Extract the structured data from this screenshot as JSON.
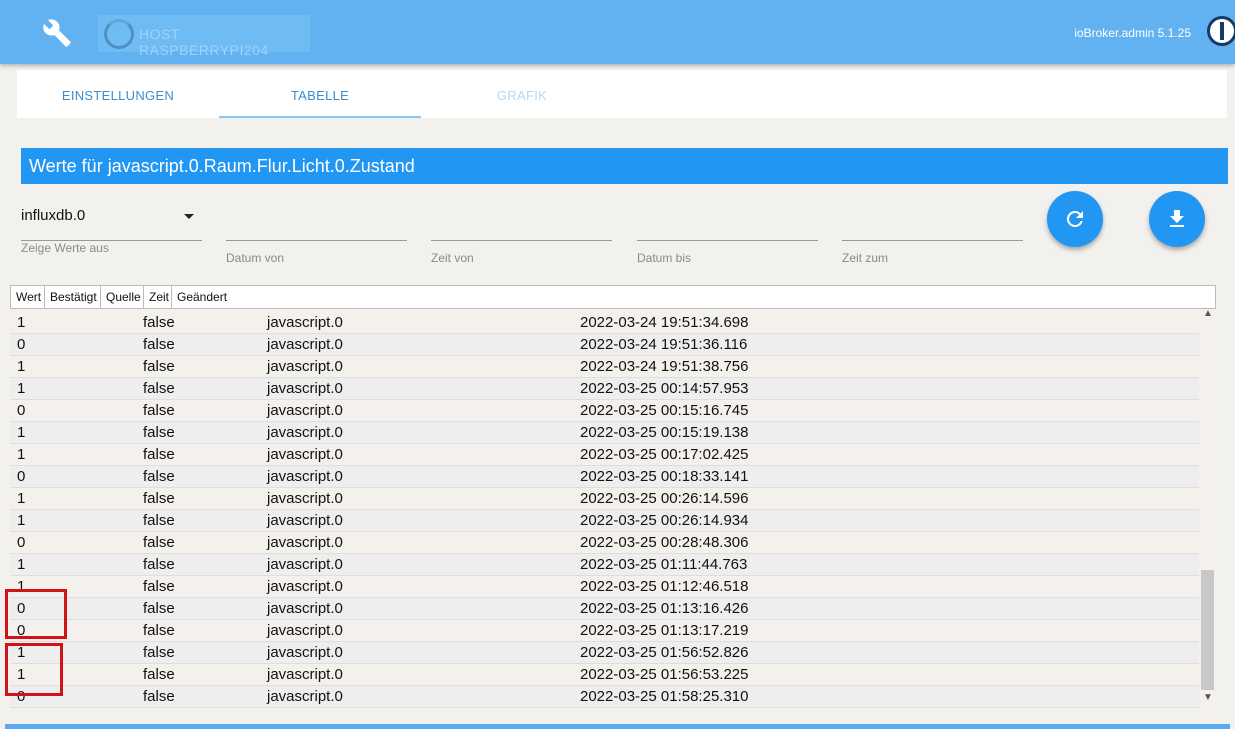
{
  "topbar": {
    "host_label": "HOST RASPBERRYPI204",
    "version": "ioBroker.admin 5.1.25",
    "wrench_icon": "wrench-icon",
    "logo_icon": "iobroker-logo"
  },
  "tabs": [
    "EINSTELLUNGEN",
    "TABELLE",
    "GRAFIK"
  ],
  "header": "Werte für javascript.0.Raum.Flur.Licht.0.Zustand",
  "filters": {
    "instance": "influxdb.0",
    "instance_label": "Zeige Werte aus",
    "date_from": "Datum von",
    "time_from": "Zeit von",
    "date_to": "Datum bis",
    "time_to": "Zeit zum"
  },
  "buttons": {
    "refresh_icon": "refresh-icon",
    "download_icon": "download-icon"
  },
  "table": {
    "columns": [
      "Wert",
      "Bestätigt",
      "Quelle",
      "Zeit",
      "Geändert"
    ],
    "rows": [
      [
        "1",
        "false",
        "javascript.0",
        "2022-03-24 19:51:34.698"
      ],
      [
        "0",
        "false",
        "javascript.0",
        "2022-03-24 19:51:36.116"
      ],
      [
        "1",
        "false",
        "javascript.0",
        "2022-03-24 19:51:38.756"
      ],
      [
        "1",
        "false",
        "javascript.0",
        "2022-03-25 00:14:57.953"
      ],
      [
        "0",
        "false",
        "javascript.0",
        "2022-03-25 00:15:16.745"
      ],
      [
        "1",
        "false",
        "javascript.0",
        "2022-03-25 00:15:19.138"
      ],
      [
        "1",
        "false",
        "javascript.0",
        "2022-03-25 00:17:02.425"
      ],
      [
        "0",
        "false",
        "javascript.0",
        "2022-03-25 00:18:33.141"
      ],
      [
        "1",
        "false",
        "javascript.0",
        "2022-03-25 00:26:14.596"
      ],
      [
        "1",
        "false",
        "javascript.0",
        "2022-03-25 00:26:14.934"
      ],
      [
        "0",
        "false",
        "javascript.0",
        "2022-03-25 00:28:48.306"
      ],
      [
        "1",
        "false",
        "javascript.0",
        "2022-03-25 01:11:44.763"
      ],
      [
        "1",
        "false",
        "javascript.0",
        "2022-03-25 01:12:46.518"
      ],
      [
        "0",
        "false",
        "javascript.0",
        "2022-03-25 01:13:16.426"
      ],
      [
        "0",
        "false",
        "javascript.0",
        "2022-03-25 01:13:17.219"
      ],
      [
        "1",
        "false",
        "javascript.0",
        "2022-03-25 01:56:52.826"
      ],
      [
        "1",
        "false",
        "javascript.0",
        "2022-03-25 01:56:53.225"
      ],
      [
        "0",
        "false",
        "javascript.0",
        "2022-03-25 01:58:25.310"
      ]
    ]
  }
}
